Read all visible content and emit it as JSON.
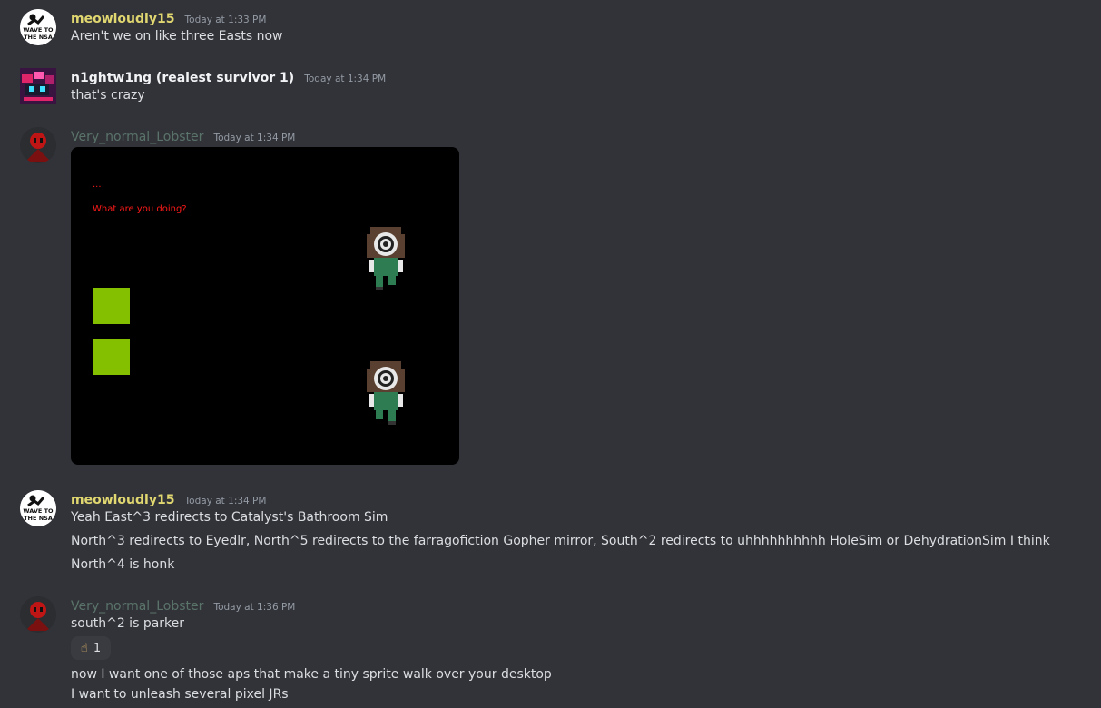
{
  "colors": {
    "background": "#323339",
    "meowloudly_name": "#e1d770",
    "nightwing_name": "#f2f3f5",
    "lobster_name": "#5a7369",
    "game_text": "#ff1a1a",
    "game_box": "#84bf00"
  },
  "messages": [
    {
      "author": "meowloudly15",
      "avatar_icon": "wave-to-the-nsa-avatar",
      "avatar_text": "WAVE TO THE NSA",
      "timestamp": "Today at 1:33 PM",
      "lines": [
        "Aren't we on like three Easts now"
      ]
    },
    {
      "author": "n1ghtw1ng (realest survivor 1)",
      "avatar_icon": "pixel-art-avatar",
      "timestamp": "Today at 1:34 PM",
      "lines": [
        "that's crazy"
      ]
    },
    {
      "author": "Very_normal_Lobster",
      "avatar_icon": "red-mask-avatar",
      "timestamp": "Today at 1:34 PM",
      "attachment": {
        "type": "game-screenshot",
        "text_ellipsis": "...",
        "text_dialogue": "What are you doing?"
      }
    },
    {
      "author": "meowloudly15",
      "avatar_icon": "wave-to-the-nsa-avatar",
      "avatar_text": "WAVE TO THE NSA",
      "timestamp": "Today at 1:34 PM",
      "lines": [
        "Yeah East^3 redirects to Catalyst's Bathroom Sim",
        "North^3 redirects to Eyedlr, North^5 redirects to the farragofiction Gopher mirror, South^2 redirects to uhhhhhhhhhh HoleSim or DehydrationSim I think",
        "North^4 is honk"
      ]
    },
    {
      "author": "Very_normal_Lobster",
      "avatar_icon": "red-mask-avatar",
      "timestamp": "Today at 1:36 PM",
      "lines": [
        "south^2 is parker",
        "now I want one of those aps that make a tiny sprite walk over your desktop",
        "I want to unleash several pixel JRs"
      ],
      "reaction": {
        "emoji": "☝",
        "icon": "pointing-up-emoji",
        "count": "1"
      }
    }
  ]
}
